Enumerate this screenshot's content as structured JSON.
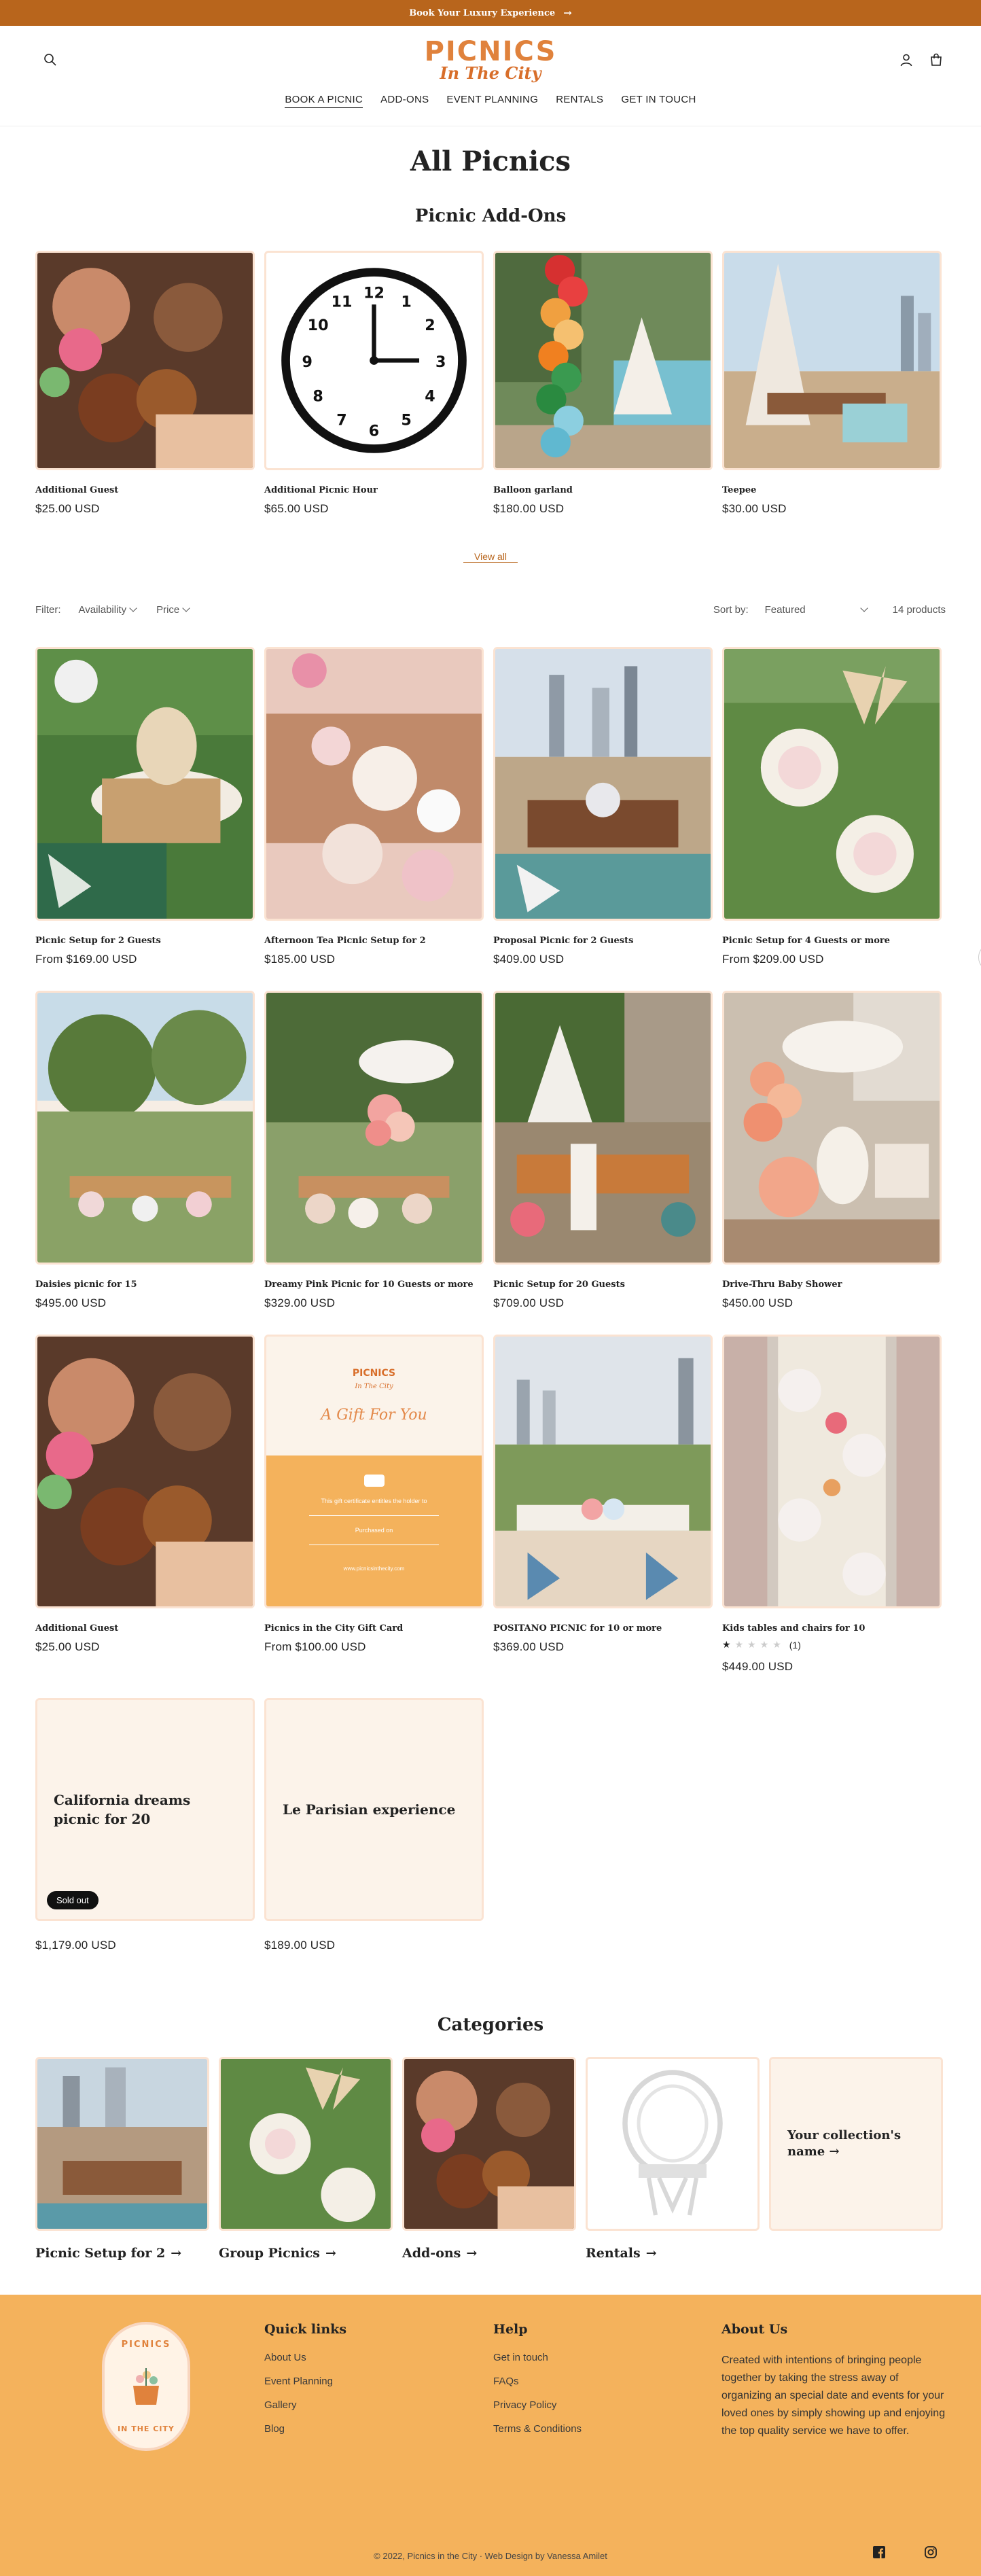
{
  "announcement": {
    "text": "Book Your Luxury Experience",
    "arrow": "→"
  },
  "brand": {
    "line1": "PICNICS",
    "line2": "In The City",
    "accent": "#e0823c",
    "bar": "#b8651c",
    "footer_bg": "#f4b25c"
  },
  "nav": [
    "BOOK A PICNIC",
    "ADD-ONS",
    "EVENT PLANNING",
    "RENTALS",
    "GET IN TOUCH"
  ],
  "page_title": "All Picnics",
  "addons": {
    "title": "Picnic Add-Ons",
    "view_all": "View all",
    "items": [
      {
        "name": "Additional Guest",
        "price": "$25.00 USD"
      },
      {
        "name": "Additional Picnic Hour",
        "price": "$65.00 USD"
      },
      {
        "name": "Balloon garland",
        "price": "$180.00 USD"
      },
      {
        "name": "Teepee",
        "price": "$30.00 USD"
      }
    ]
  },
  "filter": {
    "label": "Filter:",
    "availability": "Availability",
    "price": "Price",
    "sort_label": "Sort by:",
    "sort_value": "Featured",
    "count": "14 products"
  },
  "products": [
    {
      "name": "Picnic Setup for 2 Guests",
      "price": "From $169.00 USD"
    },
    {
      "name": "Afternoon Tea Picnic Setup for 2",
      "price": "$185.00 USD"
    },
    {
      "name": "Proposal Picnic for 2 Guests",
      "price": "$409.00 USD"
    },
    {
      "name": "Picnic Setup for 4 Guests or more",
      "price": "From $209.00 USD"
    },
    {
      "name": "Daisies picnic for 15",
      "price": "$495.00 USD"
    },
    {
      "name": "Dreamy Pink Picnic for 10 Guests or more",
      "price": "$329.00 USD"
    },
    {
      "name": "Picnic Setup for 20 Guests",
      "price": "$709.00 USD"
    },
    {
      "name": "Drive-Thru Baby Shower",
      "price": "$450.00 USD"
    },
    {
      "name": "Additional Guest",
      "price": "$25.00 USD"
    },
    {
      "name": "Picnics in the City Gift Card",
      "price": "From $100.00 USD"
    },
    {
      "name": "POSITANO PICNIC for 10 or more",
      "price": "$369.00 USD"
    },
    {
      "name": "Kids tables and chairs for 10",
      "price": "$449.00 USD",
      "rating": 1,
      "rating_max": 5,
      "review_count": "(1)"
    },
    {
      "name": "California dreams picnic for 20",
      "price": "$1,179.00 USD",
      "badge": "Sold out"
    },
    {
      "name": "Le Parisian experience",
      "price": "$189.00 USD"
    }
  ],
  "gift_card": {
    "brand1": "PICNICS",
    "brand2": "In The City",
    "headline": "A Gift For You",
    "line_a": "This gift certificate entitles the holder to",
    "line_b": "Purchased on",
    "line_c": "www.picnicsinthecity.com"
  },
  "categories": {
    "title": "Categories",
    "items": [
      {
        "name": "Picnic Setup for 2"
      },
      {
        "name": "Group Picnics"
      },
      {
        "name": "Add-ons"
      },
      {
        "name": "Rentals"
      },
      {
        "name": "Your collection's name",
        "placeholder": true
      }
    ]
  },
  "footer": {
    "badge_top": "PICNICS",
    "badge_bottom": "IN THE CITY",
    "quick_links": {
      "title": "Quick links",
      "links": [
        "About Us",
        "Event Planning",
        "Gallery",
        "Blog"
      ]
    },
    "help": {
      "title": "Help",
      "links": [
        "Get in touch",
        "FAQs",
        "Privacy Policy",
        "Terms & Conditions"
      ]
    },
    "about": {
      "title": "About Us",
      "text": "Created with intentions of bringing people together by taking the stress away of organizing an special date and events for your loved ones by simply showing up and enjoying the top quality service we have to offer."
    },
    "copyright": "© 2022, Picnics in the City · Web Design by Vanessa Amilet"
  },
  "icons": [
    "search-icon",
    "account-icon",
    "cart-icon",
    "facebook-icon",
    "instagram-icon",
    "chevron-up-icon"
  ]
}
